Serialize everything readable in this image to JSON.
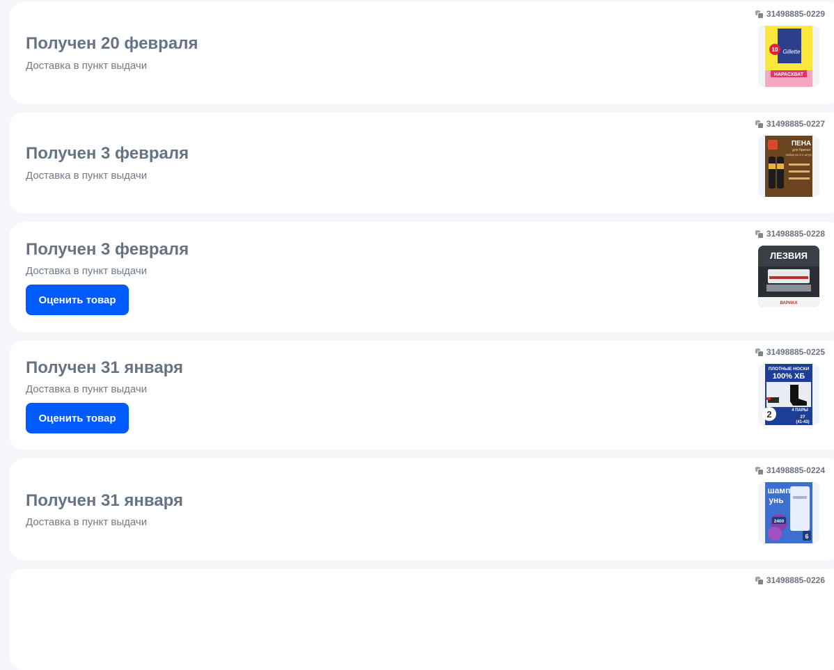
{
  "orders": [
    {
      "order_id": "31498885-0229",
      "status": "Получен 20 февраля",
      "delivery": "Доставка в пункт выдачи",
      "thumb_icon": "gillette-razor-product-image"
    },
    {
      "order_id": "31498885-0227",
      "status": "Получен 3 февраля",
      "delivery": "Доставка в пункт выдачи",
      "thumb_icon": "shaving-foam-product-image"
    },
    {
      "order_id": "31498885-0228",
      "status": "Получен 3 февраля",
      "delivery": "Доставка в пункт выдачи",
      "action": "Оценить товар",
      "thumb_icon": "razor-blades-product-image"
    },
    {
      "order_id": "31498885-0225",
      "status": "Получен 31 января",
      "delivery": "Доставка в пункт выдачи",
      "action": "Оценить товар",
      "quantity": "2",
      "thumb_icon": "socks-product-image"
    },
    {
      "order_id": "31498885-0224",
      "status": "Получен 31 января",
      "delivery": "Доставка в пункт выдачи",
      "thumb_icon": "shampoo-product-image"
    },
    {
      "order_id": "31498885-0226"
    }
  ],
  "product_text": {
    "gillette_brand": "Gillette",
    "gillette_count": "10",
    "gillette_sale": "НАРАСХВАТ",
    "foam_title": "ПЕНА",
    "foam_sub": "для бритья",
    "foam_sub2": "набор из 2-х штук",
    "blades_title": "ЛЕЗВИЯ",
    "blades_brand": "ВАРИАХ",
    "socks_l1": "ПЛОТНЫЕ НОСКИ",
    "socks_l2": "100% ХБ",
    "socks_pairs": "4 ПАРЫ",
    "socks_size": "27",
    "socks_range": "(41-43)",
    "shampoo_l1": "шамп",
    "shampoo_l2": "унь",
    "shampoo_vol": "2400",
    "shampoo_count": "6"
  },
  "colors": {
    "accent": "#005bff",
    "title": "#667382",
    "bg": "#f5f6f9"
  }
}
